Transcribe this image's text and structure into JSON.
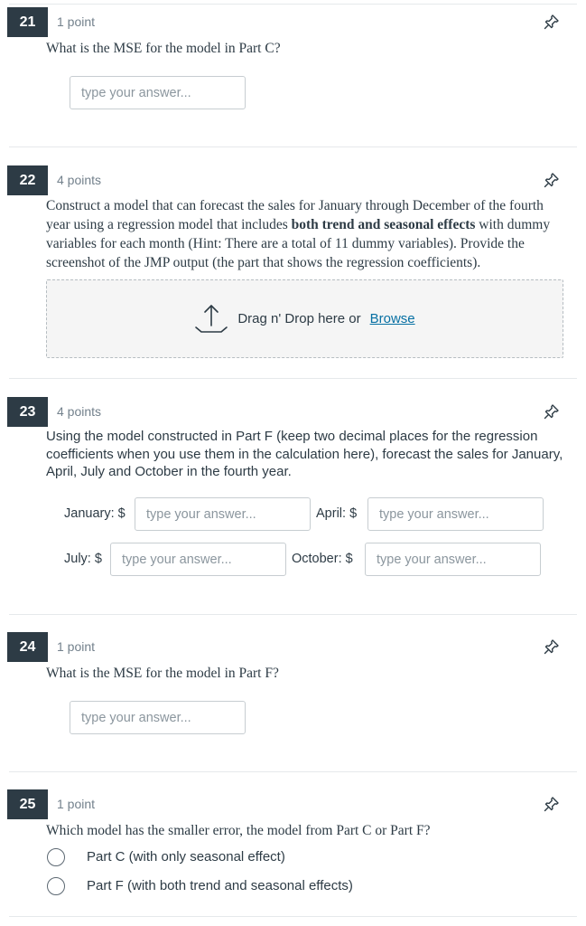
{
  "questions": {
    "q21": {
      "number": "21",
      "points": "1 point",
      "text": "What is the MSE for the model in Part C?",
      "placeholder": "type your answer..."
    },
    "q22": {
      "number": "22",
      "points": "4 points",
      "text_before": "Construct a model that can forecast the sales for January through December of the fourth year using a regression model that includes ",
      "text_bold": "both trend and seasonal effects",
      "text_after": " with dummy variables for each month (Hint: There are a total of 11 dummy variables). Provide the screenshot of the JMP output (the part that shows the regression coefficients).",
      "upload_text": "Drag n' Drop here or",
      "browse_label": "Browse"
    },
    "q23": {
      "number": "23",
      "points": "4 points",
      "text": "Using the model constructed in Part F (keep two decimal places for the regression coefficients when you use them in the calculation here), forecast the sales for January, April, July and October in the fourth year.",
      "january_label": "January: $",
      "april_label": "April: $",
      "july_label": "July: $",
      "october_label": "October: $",
      "placeholder": "type your answer..."
    },
    "q24": {
      "number": "24",
      "points": "1 point",
      "text": "What is the MSE for the model in Part F?",
      "placeholder": "type your answer..."
    },
    "q25": {
      "number": "25",
      "points": "1 point",
      "text": "Which model has the smaller error, the model from Part C or Part F?",
      "options": [
        "Part C (with only seasonal effect)",
        "Part F (with both trend and seasonal effects)"
      ]
    }
  },
  "icons": {
    "pin": "pin-icon",
    "upload": "upload-icon"
  },
  "colors": {
    "badge": "#2d3b45",
    "link": "#0770a3",
    "dropzone_bg": "#f5f5f5"
  }
}
